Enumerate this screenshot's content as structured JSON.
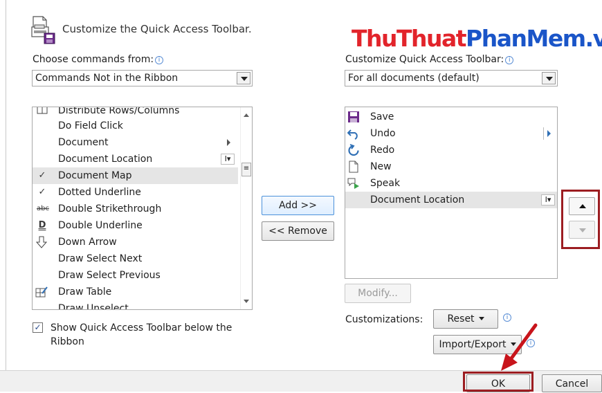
{
  "header": {
    "title": "Customize the Quick Access Toolbar.",
    "watermark_part1": "ThuThuat",
    "watermark_part2": "PhanMem.vn"
  },
  "left": {
    "label": "Choose commands from:",
    "combo_value": "Commands Not in the Ribbon",
    "items": [
      {
        "label": "Distribute Rows/Columns",
        "icon": "distribute-icon"
      },
      {
        "label": "Do Field Click",
        "icon": ""
      },
      {
        "label": "Document",
        "icon": "",
        "submenu": true
      },
      {
        "label": "Document Location",
        "icon": "",
        "textbox": true
      },
      {
        "label": "Document Map",
        "icon": "check-icon",
        "selected": true
      },
      {
        "label": "Dotted Underline",
        "icon": "check-icon"
      },
      {
        "label": "Double Strikethrough",
        "icon": "abc-strike-icon"
      },
      {
        "label": "Double Underline",
        "icon": "double-underline-icon"
      },
      {
        "label": "Down Arrow",
        "icon": "down-arrow-icon"
      },
      {
        "label": "Draw Select Next",
        "icon": ""
      },
      {
        "label": "Draw Select Previous",
        "icon": ""
      },
      {
        "label": "Draw Table",
        "icon": "draw-table-icon"
      },
      {
        "label": "Draw Unselect",
        "icon": ""
      }
    ],
    "show_below_label_line1": "Show Quick Access Toolbar below the",
    "show_below_label_line2": "Ribbon"
  },
  "middle": {
    "add_label": "Add >>",
    "remove_label": "<< Remove"
  },
  "right": {
    "label": "Customize Quick Access Toolbar:",
    "combo_value": "For all documents (default)",
    "items": [
      {
        "label": "Save",
        "icon": "save-icon"
      },
      {
        "label": "Undo",
        "icon": "undo-icon"
      },
      {
        "label": "Redo",
        "icon": "redo-icon"
      },
      {
        "label": "New",
        "icon": "new-document-icon"
      },
      {
        "label": "Speak",
        "icon": "speak-icon"
      },
      {
        "label": "Document Location",
        "icon": "",
        "selected": true
      }
    ],
    "modify_label": "Modify...",
    "customizations_label": "Customizations:",
    "reset_label": "Reset",
    "import_export_label": "Import/Export"
  },
  "footer": {
    "ok_label": "OK",
    "cancel_label": "Cancel"
  },
  "colors": {
    "highlight": "#9c1d21",
    "watermark_red": "#e2242b",
    "watermark_blue": "#1a55c8"
  }
}
